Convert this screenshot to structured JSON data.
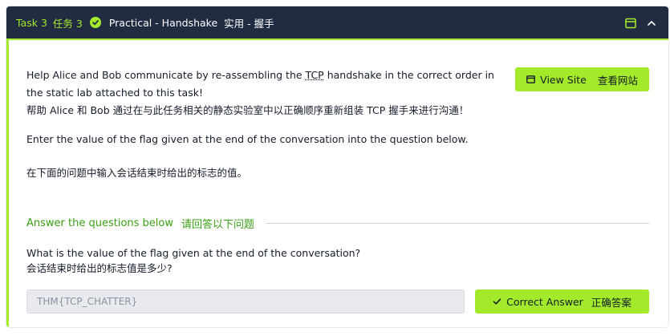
{
  "task": {
    "label": "Task 3",
    "label_zh": "任务 3",
    "title": "Practical - Handshake",
    "title_zh": "实用 - 握手",
    "status": "completed",
    "icons": [
      "check-circle-icon",
      "view-window-icon",
      "chevron-up-icon"
    ]
  },
  "description": {
    "p1_before": "Help Alice and Bob communicate by re-assembling the ",
    "p1_tcp": "TCP",
    "p1_after": " handshake in the correct order in the static lab attached to this task!",
    "p1_zh": "帮助 Alice 和 Bob 通过在与此任务相关的静态实验室中以正确顺序重新组装 TCP 握手来进行沟通！",
    "p2": "Enter the value of the flag given at the end of the conversation into the question below.",
    "p2_zh": "在下面的问题中输入会话结束时给出的标志的值。"
  },
  "view_site": {
    "label": "View Site",
    "label_zh": "查看网站",
    "icon": "browser-window-icon"
  },
  "answers_section": {
    "heading": "Answer the questions below",
    "heading_zh": "请回答以下问题"
  },
  "question": {
    "text": "What is the value of the flag given at the end of the conversation?",
    "text_zh": "会话结束时给出的标志值是多少?",
    "answer_value": "THM{TCP_CHATTER}"
  },
  "correct_button": {
    "label": "Correct Answer",
    "label_zh": "正确答案",
    "icon": "checkmark-icon"
  },
  "colors": {
    "accent": "#a3ea2a",
    "header_bg": "#212c42",
    "section_heading": "#3aa014",
    "input_bg": "#e8eaee"
  }
}
